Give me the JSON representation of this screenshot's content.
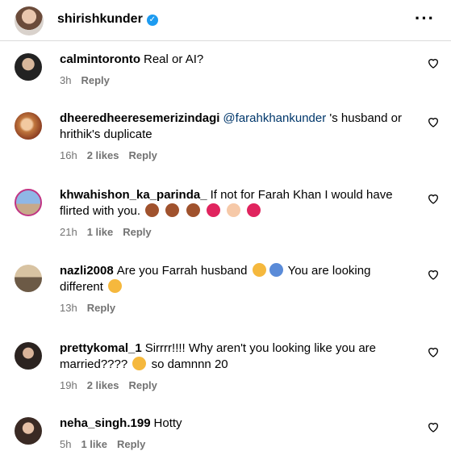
{
  "header": {
    "username": "shirishkunder",
    "verified": true,
    "more_icon": "more-horizontal-icon"
  },
  "comments": [
    {
      "user": "calmintoronto",
      "text": "Real or AI?",
      "time": "3h",
      "likes": "",
      "reply": "Reply"
    },
    {
      "user": "dheeredheeresemerizindagi",
      "mention": "@farahkhankunder",
      "text": " 's husband or hrithik's duplicate",
      "time": "16h",
      "likes": "2 likes",
      "reply": "Reply"
    },
    {
      "user": "khwahishon_ka_parinda_",
      "text": "If not for Farah Khan I would have flirted with you.",
      "emojis": "see-no-evil ×3, red-heart, heart-hands, red-heart",
      "time": "21h",
      "likes": "1 like",
      "reply": "Reply"
    },
    {
      "user": "nazli2008",
      "text": "Are you Farrah husband",
      "text2": "You are looking different",
      "time": "13h",
      "likes": "",
      "reply": "Reply"
    },
    {
      "user": "prettykomal_1",
      "text": "Sirrrr!!!! Why aren't you looking like you are married????",
      "text2": "so damnnn 20",
      "time": "19h",
      "likes": "2 likes",
      "reply": "Reply"
    },
    {
      "user": "neha_singh.199",
      "text": "Hotty",
      "time": "5h",
      "likes": "1 like",
      "reply": "Reply"
    }
  ],
  "colors": {
    "link": "#00376b",
    "meta": "#737373",
    "verified": "#1d9bf0",
    "divider": "#dbdbdb"
  }
}
